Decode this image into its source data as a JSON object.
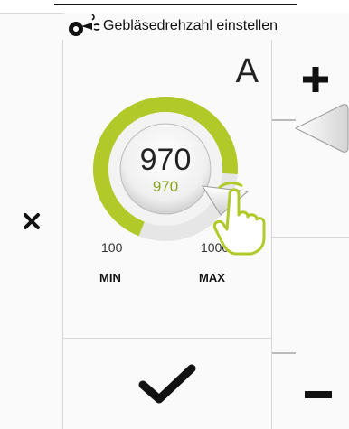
{
  "header": {
    "title": "Gebläsedrehzahl einstellen",
    "icon": "fan-speed-icon"
  },
  "mode": {
    "letter": "A"
  },
  "gauge": {
    "current_value": "970",
    "target_value": "970",
    "min_value": "100",
    "max_value": "1000",
    "min_label": "MIN",
    "max_label": "MAX",
    "fill_fraction": 0.9,
    "accent_color": "#b2c92a",
    "track_color": "#e6e6e6"
  },
  "controls": {
    "close_icon": "close-icon",
    "confirm_icon": "checkmark-icon",
    "increase_icon": "plus-icon",
    "decrease_icon": "minus-icon"
  }
}
